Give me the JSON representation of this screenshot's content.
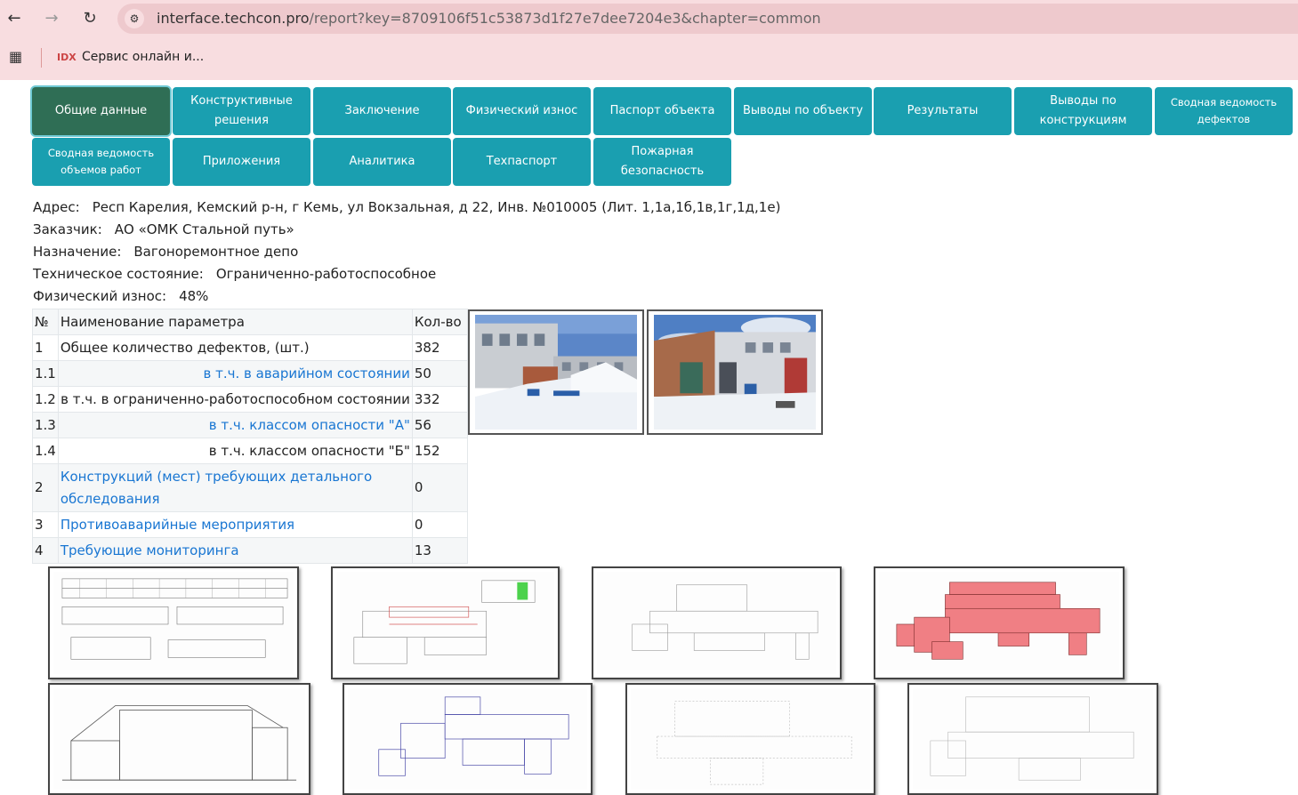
{
  "browser": {
    "url_host": "interface.techcon.pro",
    "url_rest": "/report?key=8709106f51c53873d1f27e7dee7204e3&chapter=common",
    "bookmark_logo": "IDX",
    "bookmark_label": "Сервис онлайн и..."
  },
  "tabs": [
    {
      "label": "Общие данные",
      "active": true
    },
    {
      "label": "Конструктивные решения"
    },
    {
      "label": "Заключение"
    },
    {
      "label": "Физический износ"
    },
    {
      "label": "Паспорт объекта"
    },
    {
      "label": "Выводы по объекту"
    },
    {
      "label": "Результаты"
    },
    {
      "label": "Выводы по конструкциям"
    },
    {
      "label": "Сводная ведомость дефектов"
    },
    {
      "label": "Сводная ведомость объемов работ"
    },
    {
      "label": "Приложения"
    },
    {
      "label": "Аналитика"
    },
    {
      "label": "Техпаспорт"
    },
    {
      "label": "Пожарная безопасность"
    }
  ],
  "info": {
    "address_label": "Адрес:",
    "address": "Респ Карелия, Кемский р-н, г Кемь, ул Вокзальная, д 22, Инв. №010005 (Лит. 1,1а,1б,1в,1г,1д,1е)",
    "customer_label": "Заказчик:",
    "customer": "АО «ОМК Стальной путь»",
    "purpose_label": "Назначение:",
    "purpose": "Вагоноремонтное депо",
    "condition_label": "Техническое состояние:",
    "condition": "Ограниченно-работоспособное",
    "wear_label": "Физический износ:",
    "wear": "48%"
  },
  "table": {
    "headers": {
      "num": "№",
      "name": "Наименование параметра",
      "qty": "Кол-во"
    },
    "rows": [
      {
        "num": "1",
        "name": "Общее количество дефектов, (шт.)",
        "qty": "382"
      },
      {
        "num": "1.1",
        "name": "в т.ч. в аварийном состоянии",
        "qty": "50"
      },
      {
        "num": "1.2",
        "name": "в т.ч. в ограниченно-работоспособном состоянии",
        "qty": "332"
      },
      {
        "num": "1.3",
        "name": "в т.ч. классом опасности \"А\"",
        "qty": "56"
      },
      {
        "num": "1.4",
        "name": "в т.ч. классом опасности \"Б\"",
        "qty": "152"
      },
      {
        "num": "2",
        "name": "Конструкций (мест) требующих детального обследования",
        "qty": "0"
      },
      {
        "num": "3",
        "name": "Противоаварийные мероприятия",
        "qty": "0"
      },
      {
        "num": "4",
        "name": "Требующие мониторинга",
        "qty": "13"
      }
    ]
  },
  "colors": {
    "tab": "#1a9fb0",
    "tab_active": "#2f6e55",
    "link": "#1976d2",
    "chrome": "#f8dde0"
  }
}
